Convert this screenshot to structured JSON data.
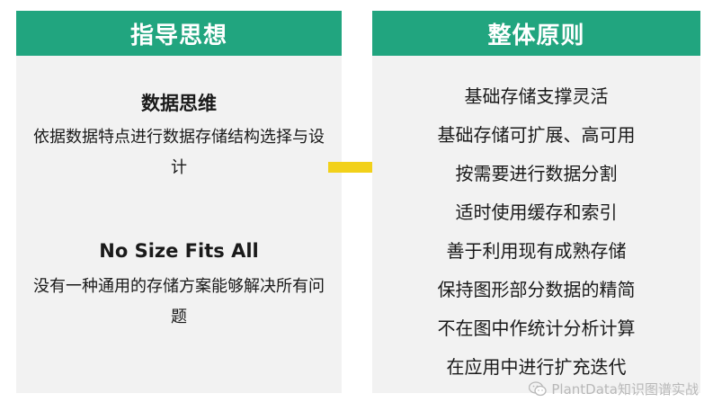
{
  "left_panel": {
    "header": "指导思想",
    "block1": {
      "title": "数据思维",
      "desc": "依据数据特点进行数据存储结构选择与设计"
    },
    "block2": {
      "title": "No Size Fits All",
      "desc": "没有一种通用的存储方案能够解决所有问题"
    }
  },
  "right_panel": {
    "header": "整体原则",
    "items": [
      "基础存储支撑灵活",
      "基础存储可扩展、高可用",
      "按需要进行数据分割",
      "适时使用缓存和索引",
      "善于利用现有成熟存储",
      "保持图形部分数据的精简",
      "不在图中作统计分析计算",
      "在应用中进行扩充迭代"
    ]
  },
  "arrow_color": "#f2d11a",
  "header_color": "#21a57f",
  "watermark": {
    "icon": "wechat-icon",
    "text": "PlantData知识图谱实战"
  }
}
